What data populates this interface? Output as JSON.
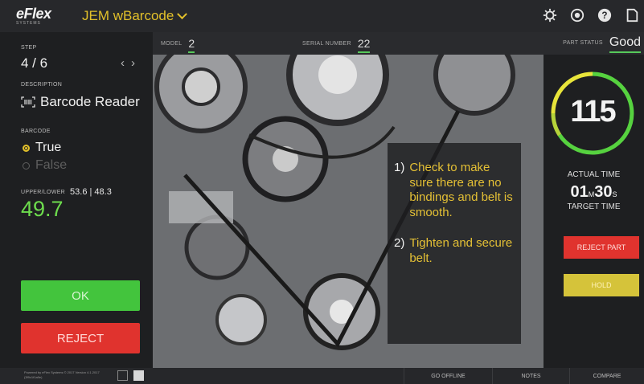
{
  "header": {
    "logo_text": "eFlex",
    "logo_sub": "SYSTEMS",
    "app_title": "JEM wBarcode",
    "icons": [
      "settings-icon",
      "help-circle-icon",
      "help-icon",
      "logout-icon"
    ]
  },
  "sidebar": {
    "step_label": "STEP",
    "step_value": "4 / 6",
    "description_label": "DESCRIPTION",
    "description_value": "Barcode Reader",
    "barcode_label": "BARCODE",
    "options": [
      "True",
      "False"
    ],
    "selected_option": "True",
    "upper_lower_label": "UPPER/LOWER",
    "upper_lower_value": "53.6 | 48.3",
    "reading": "49.7",
    "ok_label": "OK",
    "reject_label": "REJECT"
  },
  "infobar": {
    "model_label": "MODEL",
    "model_value": "2",
    "serial_label": "SERIAL NUMBER",
    "serial_value": "22",
    "part_status_label": "PART STATUS",
    "part_status_value": "Good"
  },
  "instructions": [
    {
      "num": "1)",
      "text": "Check to make sure there are no bindings and belt is smooth."
    },
    {
      "num": "2)",
      "text": "Tighten and secure belt."
    }
  ],
  "right_panel": {
    "timer_value": "115",
    "actual_time_label": "ACTUAL TIME",
    "target_min": "01",
    "target_min_unit": "M",
    "target_sec": "30",
    "target_sec_unit": "S",
    "target_time_label": "TARGET TIME",
    "reject_part_label": "REJECT PART",
    "hold_label": "HOLD"
  },
  "footer": {
    "powered_by": "Powered by eFlex Systems © 2017 Version 4.1.2017 (3f9c1f1a9e)",
    "go_offline": "GO OFFLINE",
    "notes": "NOTES",
    "compare": "COMPARE"
  },
  "colors": {
    "accent_yellow": "#e2c02a",
    "ok_green": "#43c43d",
    "reject_red": "#e0332e",
    "hold_yellow": "#d5c33a",
    "reading_green": "#6ddc4d"
  }
}
